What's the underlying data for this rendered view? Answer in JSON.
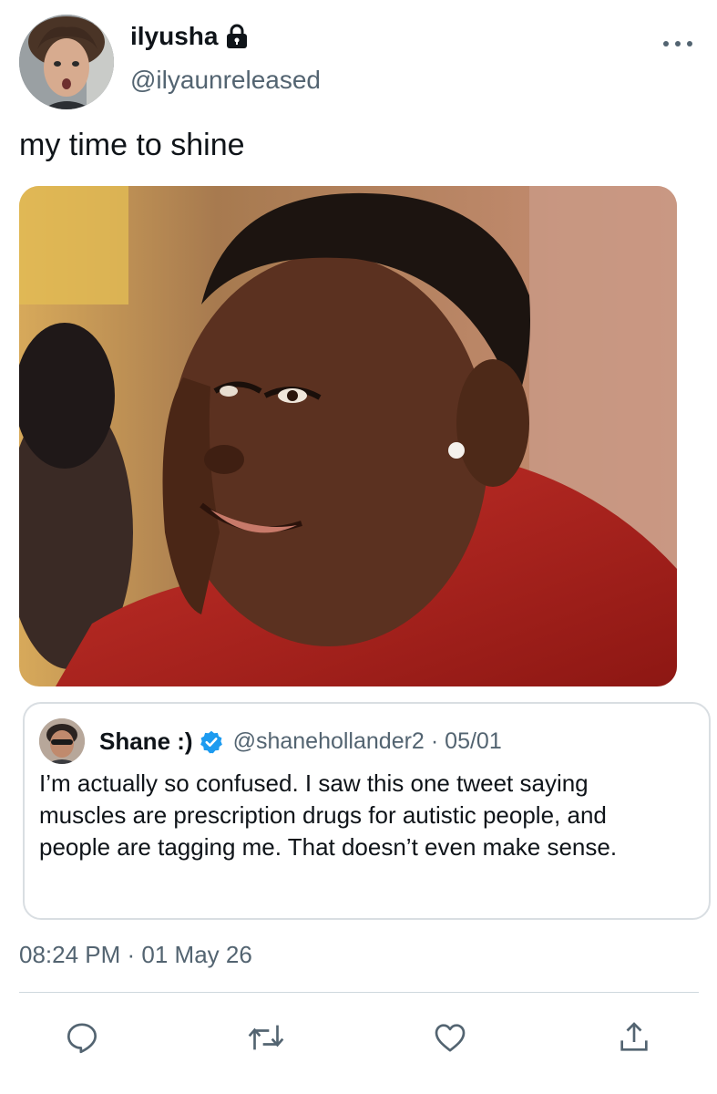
{
  "author": {
    "display_name": "ilyusha",
    "handle": "@ilyaunreleased",
    "avatar": "avatar-photo",
    "protected_icon": "lock-icon"
  },
  "tweet": {
    "text": "my time to shine",
    "media": "photo of smiling man in red shirt looking over shoulder",
    "timestamp": "08:24 PM · 01 May 26"
  },
  "quoted": {
    "display_name": "Shane :)",
    "verified_icon": "verified-badge-icon",
    "handle": "@shanehollander2",
    "separator": "·",
    "date": "05/01",
    "text": "I’m actually so confused. I saw this one tweet saying muscles are prescription drugs for autistic people, and people are tagging me. That doesn’t even make sense."
  },
  "actions": [
    "reply-icon",
    "retweet-icon",
    "like-icon",
    "share-icon"
  ],
  "colors": {
    "text": "#0f1419",
    "secondary": "#536471",
    "verified": "#1d9bf0",
    "border": "#d9dee2"
  }
}
